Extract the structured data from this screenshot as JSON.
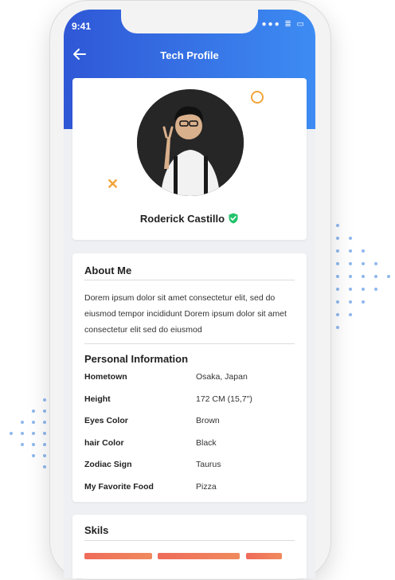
{
  "status_bar": {
    "time": "9:41",
    "icons": "●●● ≣ ▭"
  },
  "header": {
    "title": "Tech Profile"
  },
  "profile": {
    "name": "Roderick Castillo"
  },
  "about": {
    "title": "About Me",
    "text": "Dorem ipsum dolor sit amet consectetur elit, sed do eiusmod tempor incididunt Dorem ipsum dolor sit amet consectetur elit sed do eiusmod"
  },
  "personal": {
    "title": "Personal Information",
    "rows": [
      {
        "label": "Hometown",
        "value": "Osaka, Japan"
      },
      {
        "label": "Height",
        "value": "172 CM (15,7\")"
      },
      {
        "label": "Eyes Color",
        "value": "Brown"
      },
      {
        "label": "hair Color",
        "value": "Black"
      },
      {
        "label": "Zodiac Sign",
        "value": "Taurus"
      },
      {
        "label": "My Favorite Food",
        "value": "Pizza"
      }
    ]
  },
  "skills": {
    "title": "Skils"
  },
  "colors": {
    "accent": "#3d6fe6",
    "orange": "#f2a43a",
    "verified": "#22c36b",
    "skill_bar": "#ef6b5a"
  }
}
